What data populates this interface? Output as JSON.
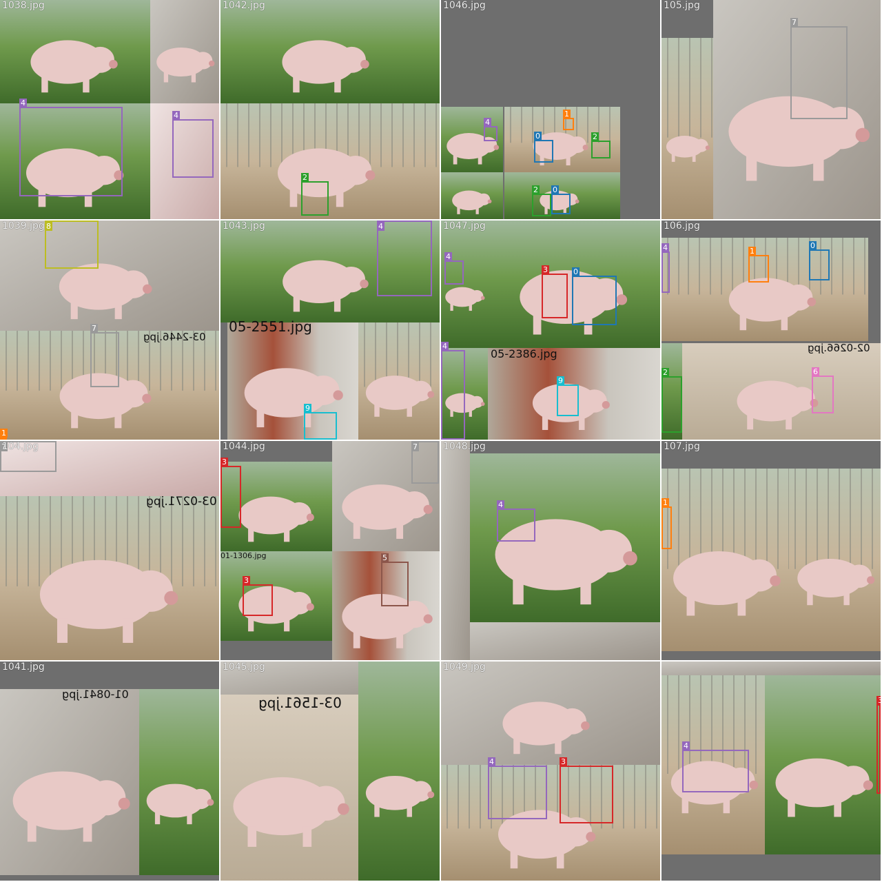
{
  "title": "",
  "colors": {
    "0": "#1f77b4",
    "1": "#ff7f0e",
    "2": "#2ca02c",
    "3": "#d62728",
    "4": "#9467bd",
    "5": "#8c564b",
    "6": "#e377c2",
    "7": "#9a9a9a",
    "8": "#bcbd22",
    "9": "#17becf"
  },
  "tiles": [
    {
      "file": "1038.jpg",
      "scene": "pasture",
      "stray": "",
      "labels": [
        "4",
        "4"
      ]
    },
    {
      "file": "1042.jpg",
      "scene": "pasture",
      "stray": "",
      "labels": [
        "2"
      ]
    },
    {
      "file": "1046.jpg",
      "scene": "blank",
      "stray": "",
      "labels": [
        "4",
        "1",
        "0",
        "2",
        "2",
        "0"
      ]
    },
    {
      "file": "105.jpg",
      "scene": "pen",
      "stray": "",
      "labels": [
        "7"
      ]
    },
    {
      "file": "1039.jpg",
      "scene": "pen",
      "stray": "03-2446.jpg",
      "labels": [
        "8",
        "7",
        "1"
      ]
    },
    {
      "file": "1043.jpg",
      "scene": "wall",
      "stray": "05-2551.jpg",
      "labels": [
        "4",
        "9"
      ]
    },
    {
      "file": "1047.jpg",
      "scene": "pasture",
      "stray": "05-2386.jpg",
      "labels": [
        "4",
        "3",
        "0",
        "4",
        "9"
      ]
    },
    {
      "file": "106.jpg",
      "scene": "pen",
      "stray": "02-0266.jpg",
      "labels": [
        "4",
        "1",
        "0",
        "2",
        "6"
      ]
    },
    {
      "file": "104.jpg",
      "scene": "pen",
      "stray": "03-0271.jpg",
      "labels": [
        "7"
      ]
    },
    {
      "file": "1044.jpg",
      "scene": "pasture",
      "stray": "01-1306.jpg",
      "labels": [
        "3",
        "3",
        "7",
        "5"
      ]
    },
    {
      "file": "1048.jpg",
      "scene": "pasture",
      "stray": "",
      "labels": [
        "4"
      ]
    },
    {
      "file": "107.jpg",
      "scene": "pen",
      "stray": "",
      "labels": [
        "1"
      ]
    },
    {
      "file": "1041.jpg",
      "scene": "ground",
      "stray": "01-0841.jpg",
      "labels": []
    },
    {
      "file": "1045.jpg",
      "scene": "ground",
      "stray": "03-1561.jpg",
      "labels": []
    },
    {
      "file": "1049.jpg",
      "scene": "ground",
      "stray": "",
      "labels": [
        "4",
        "3"
      ]
    },
    {
      "file": "",
      "scene": "pasture",
      "stray": "",
      "labels": [
        "4",
        "3"
      ]
    }
  ]
}
